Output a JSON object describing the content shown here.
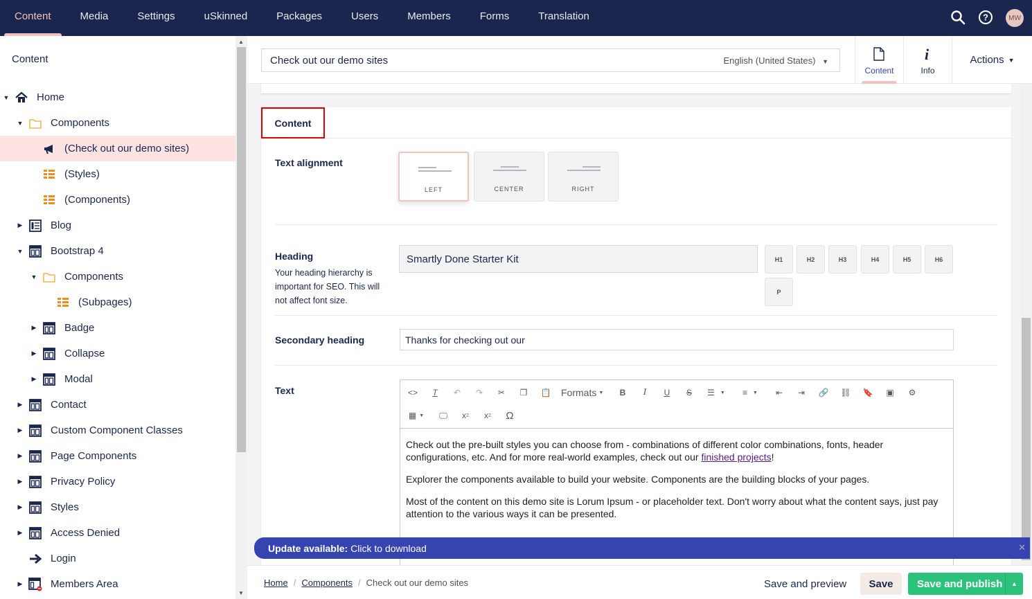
{
  "topnav": {
    "items": [
      {
        "label": "Content"
      },
      {
        "label": "Media"
      },
      {
        "label": "Settings"
      },
      {
        "label": "uSkinned"
      },
      {
        "label": "Packages"
      },
      {
        "label": "Users"
      },
      {
        "label": "Members"
      },
      {
        "label": "Forms"
      },
      {
        "label": "Translation"
      }
    ],
    "active_index": 0,
    "avatar_initials": "MW"
  },
  "sidebar": {
    "title": "Content",
    "tree": [
      {
        "label": "Home",
        "icon": "home-icon",
        "depth": 0,
        "caret": "expanded"
      },
      {
        "label": "Components",
        "icon": "folder-icon",
        "depth": 1,
        "caret": "expanded"
      },
      {
        "label": "(Check out our demo sites)",
        "icon": "megaphone-icon",
        "depth": 2,
        "caret": "none",
        "selected": true
      },
      {
        "label": "(Styles)",
        "icon": "grid-icon",
        "depth": 2,
        "caret": "none"
      },
      {
        "label": "(Components)",
        "icon": "grid-icon",
        "depth": 2,
        "caret": "none"
      },
      {
        "label": "Blog",
        "icon": "list-page-icon",
        "depth": 1,
        "caret": "collapsed"
      },
      {
        "label": "Bootstrap 4",
        "icon": "page-icon",
        "depth": 1,
        "caret": "expanded"
      },
      {
        "label": "Components",
        "icon": "folder-icon",
        "depth": 2,
        "caret": "expanded"
      },
      {
        "label": "(Subpages)",
        "icon": "grid-icon",
        "depth": 3,
        "caret": "none"
      },
      {
        "label": "Badge",
        "icon": "page-icon",
        "depth": 2,
        "caret": "collapsed"
      },
      {
        "label": "Collapse",
        "icon": "page-icon",
        "depth": 2,
        "caret": "collapsed"
      },
      {
        "label": "Modal",
        "icon": "page-icon",
        "depth": 2,
        "caret": "collapsed"
      },
      {
        "label": "Contact",
        "icon": "page-icon",
        "depth": 1,
        "caret": "collapsed"
      },
      {
        "label": "Custom Component Classes",
        "icon": "page-icon",
        "depth": 1,
        "caret": "collapsed"
      },
      {
        "label": "Page Components",
        "icon": "page-icon",
        "depth": 1,
        "caret": "collapsed"
      },
      {
        "label": "Privacy Policy",
        "icon": "page-icon",
        "depth": 1,
        "caret": "collapsed"
      },
      {
        "label": "Styles",
        "icon": "page-icon",
        "depth": 1,
        "caret": "collapsed"
      },
      {
        "label": "Access Denied",
        "icon": "page-icon",
        "depth": 1,
        "caret": "collapsed"
      },
      {
        "label": "Login",
        "icon": "arrow-right-icon",
        "depth": 1,
        "caret": "none"
      },
      {
        "label": "Members Area",
        "icon": "restricted-page-icon",
        "depth": 1,
        "caret": "collapsed"
      }
    ]
  },
  "editor": {
    "node_name": "Check out our demo sites",
    "language": "English (United States)",
    "app_tabs": [
      {
        "label": "Content",
        "icon": "document-icon"
      },
      {
        "label": "Info",
        "icon": "info-icon"
      }
    ],
    "actions_label": "Actions"
  },
  "panel": {
    "tab_label": "Content",
    "text_alignment": {
      "label": "Text alignment",
      "options": [
        "LEFT",
        "CENTER",
        "RIGHT"
      ],
      "selected": "LEFT"
    },
    "heading": {
      "label": "Heading",
      "description": "Your heading hierarchy is important for SEO. This will not affect font size.",
      "value": "Smartly Done Starter Kit",
      "levels": [
        "H1",
        "H2",
        "H3",
        "H4",
        "H5",
        "H6",
        "P"
      ]
    },
    "secondary_heading": {
      "label": "Secondary heading",
      "value": "Thanks for checking out our"
    },
    "text": {
      "label": "Text",
      "toolbar_formats": "Formats",
      "paragraphs": {
        "p1_before": "Check out the pre-built styles you can choose from - combinations of different color combinations, fonts, header configurations, etc. And for more real-world examples, check out our ",
        "p1_link": "finished projects",
        "p1_after": "!",
        "p2": "Explorer the components available to build your website. Components are the building blocks of your pages.",
        "p3": "Most of the content on this demo site is Lorum Ipsum - or placeholder text. Don't worry about what the content says, just pay attention to the various ways it can be presented."
      }
    }
  },
  "update_banner": {
    "bold": "Update available:",
    "text": "Click to download"
  },
  "footer": {
    "breadcrumb": [
      "Home",
      "Components",
      "Check out our demo sites"
    ],
    "save_preview": "Save and preview",
    "save": "Save",
    "save_publish": "Save and publish"
  },
  "colors": {
    "topbar": "#1b264f",
    "accent_pink": "#f5c1bc",
    "publish_green": "#2bc37c",
    "banner_blue": "#3544b1",
    "highlight_red": "#e00000"
  }
}
